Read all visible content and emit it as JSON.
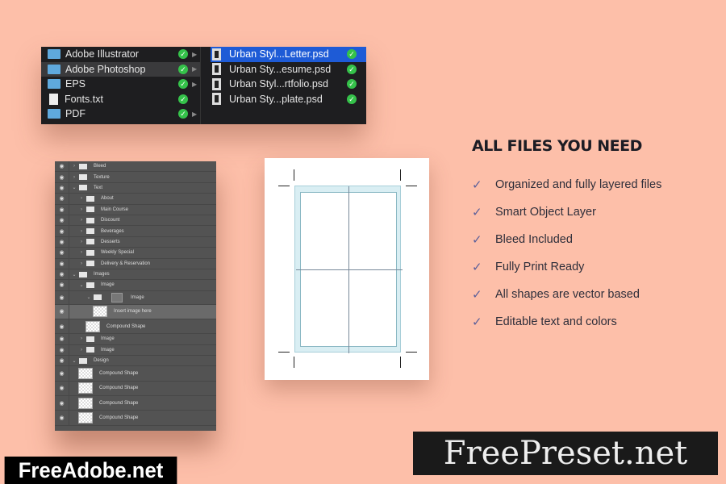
{
  "finder": {
    "left": [
      {
        "name": "Adobe Illustrator",
        "type": "folder",
        "synced": true,
        "has_children": true
      },
      {
        "name": "Adobe Photoshop",
        "type": "folder",
        "synced": true,
        "has_children": true,
        "selected": true
      },
      {
        "name": "EPS",
        "type": "folder",
        "synced": true,
        "has_children": true
      },
      {
        "name": "Fonts.txt",
        "type": "file",
        "synced": true,
        "has_children": false
      },
      {
        "name": "PDF",
        "type": "folder",
        "synced": true,
        "has_children": true
      }
    ],
    "right": [
      {
        "name": "Urban Styl...Letter.psd",
        "active": true
      },
      {
        "name": "Urban Sty...esume.psd"
      },
      {
        "name": "Urban Styl...rtfolio.psd"
      },
      {
        "name": "Urban Sty...plate.psd"
      }
    ],
    "check_glyph": "✓",
    "arrow_glyph": "▶"
  },
  "layers": [
    {
      "name": "Bleed",
      "indent": 0,
      "kind": "group",
      "open": false
    },
    {
      "name": "Texture",
      "indent": 0,
      "kind": "group",
      "open": false
    },
    {
      "name": "Text",
      "indent": 0,
      "kind": "group",
      "open": true
    },
    {
      "name": "About",
      "indent": 1,
      "kind": "group",
      "open": false
    },
    {
      "name": "Main Course",
      "indent": 1,
      "kind": "group",
      "open": false
    },
    {
      "name": "Discount",
      "indent": 1,
      "kind": "group",
      "open": false
    },
    {
      "name": "Beverages",
      "indent": 1,
      "kind": "group",
      "open": false
    },
    {
      "name": "Desserts",
      "indent": 1,
      "kind": "group",
      "open": false
    },
    {
      "name": "Weekly Special",
      "indent": 1,
      "kind": "group",
      "open": false
    },
    {
      "name": "Delivery & Reservation",
      "indent": 1,
      "kind": "group",
      "open": false
    },
    {
      "name": "Images",
      "indent": 0,
      "kind": "group",
      "open": true
    },
    {
      "name": "Image",
      "indent": 1,
      "kind": "group",
      "open": true
    },
    {
      "name": "Image",
      "indent": 2,
      "kind": "group-masked",
      "open": true
    },
    {
      "name": "Insert image here",
      "indent": 3,
      "kind": "smart",
      "highlighted": true
    },
    {
      "name": "Compound Shape",
      "indent": 2,
      "kind": "shape"
    },
    {
      "name": "Image",
      "indent": 1,
      "kind": "group",
      "open": false
    },
    {
      "name": "Image",
      "indent": 1,
      "kind": "group",
      "open": false
    },
    {
      "name": "Design",
      "indent": 0,
      "kind": "group",
      "open": true
    },
    {
      "name": "Compound Shape",
      "indent": 1,
      "kind": "shape"
    },
    {
      "name": "Compound Shape",
      "indent": 1,
      "kind": "shape"
    },
    {
      "name": "Compound Shape",
      "indent": 1,
      "kind": "shape"
    },
    {
      "name": "Compound Shape",
      "indent": 1,
      "kind": "shape"
    }
  ],
  "features": {
    "title": "ALL FILES YOU NEED",
    "items": [
      "Organized and fully layered files",
      "Smart Object Layer",
      "Bleed Included",
      "Fully Print Ready",
      "All shapes are vector based",
      "Editable text and colors"
    ],
    "check_color": "#5a5f9a"
  },
  "watermarks": {
    "left": "FreeAdobe.net",
    "right": "FreePreset.net"
  },
  "colors": {
    "background": "#fdbfa9",
    "selection": "#1e5bd6",
    "sync_green": "#35c24a"
  }
}
